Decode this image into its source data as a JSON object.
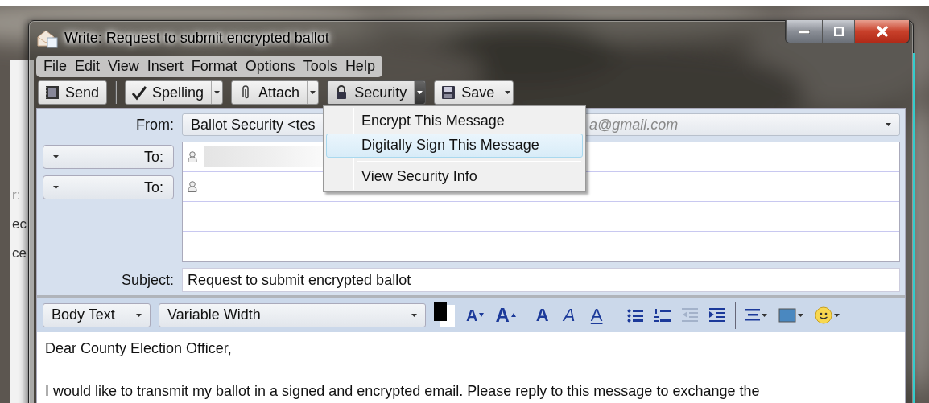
{
  "background_window": {
    "fragments": [
      "r:",
      "ec",
      "ce"
    ]
  },
  "window": {
    "title": "Write: Request to submit encrypted ballot"
  },
  "menu_bar": [
    "File",
    "Edit",
    "View",
    "Insert",
    "Format",
    "Options",
    "Tools",
    "Help"
  ],
  "toolbar": [
    {
      "kind": "send",
      "label": "Send",
      "has_dropdown": false,
      "open": false
    },
    {
      "kind": "spelling",
      "label": "Spelling",
      "has_dropdown": true,
      "open": false
    },
    {
      "kind": "attach",
      "label": "Attach",
      "has_dropdown": true,
      "open": false
    },
    {
      "kind": "security",
      "label": "Security",
      "has_dropdown": true,
      "open": true
    },
    {
      "kind": "save",
      "label": "Save",
      "has_dropdown": true,
      "open": false
    }
  ],
  "security_menu": [
    {
      "label": "Encrypt This Message",
      "selected": false
    },
    {
      "label": "Digitally Sign This Message",
      "selected": true
    },
    {
      "label": "View Security Info",
      "selected": false
    }
  ],
  "header": {
    "from": {
      "label": "From:",
      "value_start": "Ballot Security <tes",
      "value_end": "a@gmail.com"
    },
    "recipients": [
      {
        "type_label": "To:",
        "redacted": true
      },
      {
        "type_label": "To:",
        "redacted": false
      }
    ],
    "subject": {
      "label": "Subject:",
      "value": "Request to submit encrypted ballot"
    }
  },
  "format_bar": {
    "paragraph_style": "Body Text",
    "font": "Variable Width",
    "buttons": [
      {
        "kind": "smaller",
        "glyph": "A",
        "disabled": false
      },
      {
        "kind": "larger",
        "glyph": "A",
        "disabled": false
      },
      {
        "kind": "bold",
        "glyph": "A",
        "disabled": false
      },
      {
        "kind": "italic",
        "glyph": "A",
        "disabled": false
      },
      {
        "kind": "underline",
        "glyph": "A",
        "disabled": false
      },
      {
        "kind": "bullets",
        "disabled": false
      },
      {
        "kind": "numbers",
        "disabled": false
      },
      {
        "kind": "outdent",
        "disabled": true
      },
      {
        "kind": "indent",
        "disabled": false
      },
      {
        "kind": "align",
        "disabled": false
      },
      {
        "kind": "insert",
        "disabled": false
      },
      {
        "kind": "smiley",
        "disabled": false
      }
    ]
  },
  "body": [
    "Dear County Election Officer,",
    "I would like to transmit my ballot in a signed and encrypted email. Please reply to this message to exchange the"
  ]
}
